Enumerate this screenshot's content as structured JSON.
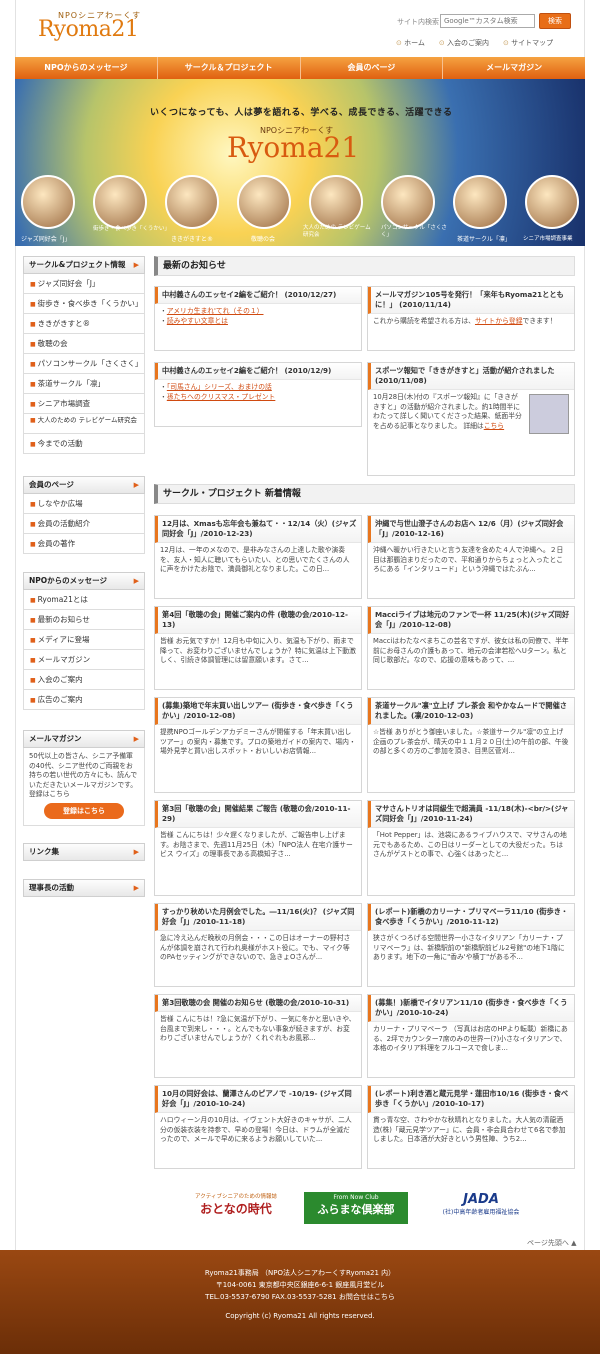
{
  "header": {
    "logo_sub": "NPOシニアわーくす",
    "logo": "Ryoma21",
    "search_label": "サイト内検索",
    "search_placeholder": "Google™カスタム検索",
    "search_button": "検索",
    "links": [
      "ホーム",
      "入会のご案内",
      "サイトマップ"
    ]
  },
  "nav": [
    "NPOからのメッセージ",
    "サークル＆プロジェクト",
    "会員のページ",
    "メールマガジン"
  ],
  "hero": {
    "tagline": "いくつになっても、人は夢を語れる、学べる、成長できる、活躍できる",
    "sub": "NPOシニアわーくす",
    "logo": "Ryoma21",
    "circles": [
      "ジャズ同好会「J」",
      "街歩き・食べ歩き「くうかい」",
      "ききがきすと®",
      "敬聴の会",
      "大人のための テレビゲーム研究会",
      "パソコンサークル「さくさく」",
      "茶道サークル「凛」",
      "シニア市場調査事業"
    ]
  },
  "sidebar": {
    "circle_title": "サークル&プロジェクト情報",
    "circle_items": [
      "ジャズ同好会「J」",
      "街歩き・食べ歩き「くうかい」",
      "ききがきすと®",
      "敬聴の会",
      "パソコンサークル「さくさく」",
      "茶道サークル「凛」",
      "シニア市場調査",
      "大人のための テレビゲーム研究会",
      "今までの活動"
    ],
    "member_title": "会員のページ",
    "member_items": [
      "しなやか広場",
      "会員の活動紹介",
      "会員の著作"
    ],
    "npo_title": "NPOからのメッセージ",
    "npo_items": [
      "Ryoma21とは",
      "最新のお知らせ",
      "メディアに登場",
      "メールマガジン",
      "入会のご案内",
      "広告のご案内"
    ],
    "mm_title": "メールマガジン",
    "mm_text": "50代以上の皆さん、シニア予備軍の40代、シニア世代のご両親をお持ちの若い世代の方々にも、読んでいただきたいメールマガジンです。 登録はこちら",
    "mm_button": "登録はこちら",
    "links_title": "リンク集",
    "chair_title": "理事長の活動"
  },
  "news": {
    "title": "最新のお知らせ",
    "items": [
      {
        "title": "中村義さんのエッセイ2編をご紹介！ (2010/12/27)",
        "links": [
          "アメリカ生まれ'てれ（その１）",
          "読みやすい文章とは"
        ]
      },
      {
        "title": "メールマガジン105号を発行！「来年もRyoma21とともに！」 (2010/11/14)",
        "text": "これから購読を希望される方は、",
        "link": "サイトから登録",
        "text2": "できます！"
      },
      {
        "title": "中村義さんのエッセイ2編をご紹介！ (2010/12/9)",
        "links": [
          "「司馬さん」シリーズ、おまけの話",
          "孫たちへのクリスマス・プレゼント"
        ]
      },
      {
        "title": "スポーツ報知で「ききがきすと」活動が紹介されました (2010/11/08)",
        "text": "10月28日(木)付の『スポーツ報知』に「ききがきすと」の活動が紹介されました。約1時間半にわたって詳しく聞いてくださった結果、紙面半分を占める記事となりました。 詳細は",
        "link": "こちら"
      }
    ]
  },
  "projects": {
    "title": "サークル・プロジェクト 新着情報",
    "items": [
      {
        "title": "12月は、Xmasも忘年会も兼ねて・・12/14（火）(ジャズ同好会「J」/2010-12-23)",
        "text": "12月は、一年のメなので、是非みなさんの上達した歌や演奏を、友人・知人に聴いてもらいたい、との思いでたくさんの人に声をかけたお陰で、満員御礼となりました。この日..."
      },
      {
        "title": "沖縄で与世山澄子さんのお店へ 12/6（月）(ジャズ同好会「J」/2010-12-16)",
        "text": "沖縄へ暖かい行きたいと言う友達を含めた４人で沖縄へ。２日目は那覇泊まりだったので、平和通りからちょっと入ったところにある「インタリュード」という沖縄ではたぶん..."
      },
      {
        "title": "第4回「敬聴の会」開催ご案内の件 (敬聴の会/2010-12-13)",
        "text": "皆様 お元気ですか！12月も中旬に入り、気温も下がり、雨まで降って、お変わりございませんでしょうか？特に気温は上下動激しく、引続き体調管理には留意願います。さて..."
      },
      {
        "title": "Macciライブは地元のファンで一杯 11/25(木)(ジャズ同好会「J」/2010-12-08)",
        "text": "Macciはわたなべまちこの芸名ですが、彼女は私の同僚で、半年前にお母さんの介護もあって、地元の会津若松へUターン。私と同じ歌部だ。なので、応援の意味もあって、..."
      },
      {
        "title": "(募集)築地で年末買い出しツアー (街歩き・食べ歩き「くうかい」/2010-12-08)",
        "text": "提携NPOゴールデンアカデミーさんが開催する「年末買い出しツアー」の案内・募集です。プロの築地ガイドの案内で、場内・場外見学と買い出しスポット・おいしいお店情報..."
      },
      {
        "title": "茶道サークル\"凛\"立上げ プレ茶会 和やかなムードで開催されました。(凛/2010-12-03)",
        "text": "☆皆様 ありがとう御座いました。☆茶道サークル\"凛\"の立上げ企画のプレ茶会が、晴天の中１１月２０日(土)の午前の部、午後の部と多くの方のご参加を頂き、目黒区菅刈..."
      },
      {
        "title": "第3回「敬聴の会」開催結果 ご報告 (敬聴の会/2010-11-29)",
        "text": "皆様 こんにちは！少々遅くなりましたが、ご報告申し上げます。お陰さまで、先週11月25日（木）「NPO法人 在宅介護サービス ウイズ」の理事長である高橋知子さ..."
      },
      {
        "title": "マサさんトリオは同級生で超満員 -11/18(木)-<br/>(ジャズ同好会「J」/2010-11-24)",
        "text": "「Hot Pepper」は、池袋にあるライブハウスで、マサさんの地元でもあるため、この日はリーダーとしての大役だった。ちはさんがゲストとの事で、心強くはあったと..."
      },
      {
        "title": "すっかり秋めいた月例会でした。―11/16(火)？ (ジャズ同好会「J」/2010-11-18)",
        "text": "急に冷え込んだ晩秋の月例会・・・この日はオーナーの野村さんが体調を崩されて行われ奥様がホスト役に。でも、マイク等のPAセッティングができないので、急きょOさんが..."
      },
      {
        "title": "(レポート)新橋のカリーナ・プリマベーラ11/10 (街歩き・食べ歩き「くうかい」/2010-11-12)",
        "text": "狭さがくつろげる空間世界一小さなイタリアン「カリーナ・プリマベーラ」は、新橋駅前の\"新橋駅前ビル2号館\"の地下1階にあります。地下の一角に\"香み'や横丁\"がある不..."
      },
      {
        "title": "第3回敬聴の会 開催のお知らせ (敬聴の会/2010-10-31)",
        "text": "皆様 こんにちは！?急に気温が下がり、一気に冬かと思いきや、台風まで到来し・・・。とんでもない事象が続きますが、お変わりございませんでしょうか？くれぐれもお風邪..."
      },
      {
        "title": "(募集！)新橋でイタリアン11/10 (街歩き・食べ歩き「くうかい」/2010-10-24)",
        "text": "カリーナ・プリマベーラ （写真はお店のHPより転載）新橋にある、2坪でカウンター7席のみの世界一(?)小さなイタリアンで、本格のイタリア料理をフルコースで食しま..."
      },
      {
        "title": "10月の同好会は、蘭澤さんのピアノで -10/19- (ジャズ同好会「J」/2010-10-24)",
        "text": "ハロウィーン月の10月は、イヴェント大好きのキャサが、二人分の仮装衣装を持参で、早めの登場！今日は、ドラムが全滅だったので、メールで早めに来るようお願いしていた..."
      },
      {
        "title": "(レポート)利き酒と蔵元見学・蓮田市10/16 (街歩き・食べ歩き「くうかい」/2010-10-17)",
        "text": "貫っ青な空、さわやかな秋晴れとなりました。大人気の清龍酒造(株)「蔵元見学ツアー」に、会員・非会員合わせて6名で参加しました。日本酒が大好きという男性陣、うち2..."
      }
    ]
  },
  "logos": {
    "l1a": "アクティブシニアのための情報誌",
    "l1b": "おとなの時代",
    "l2a": "From Now Club",
    "l2b": "ふらまな倶楽部",
    "l3a": "JADA",
    "l3b": "(社)中高年齢者雇用福祉協会"
  },
  "pagetop": "ページ先頭へ ▲",
  "footer": {
    "l1": "Ryoma21事務局 （NPO法人シニアわーくすRyoma21 内）",
    "l2": "〒104-0061 東京都中央区銀座6-6-1 銀座風月堂ビル",
    "l3": "TEL.03-5537-6790 FAX.03-5537-5281 お問合せはこちら",
    "copy": "Copyright (c) Ryoma21 All rights reserved."
  },
  "colors": {
    "accent": "#e8761e",
    "footer": "#8a3e10"
  }
}
